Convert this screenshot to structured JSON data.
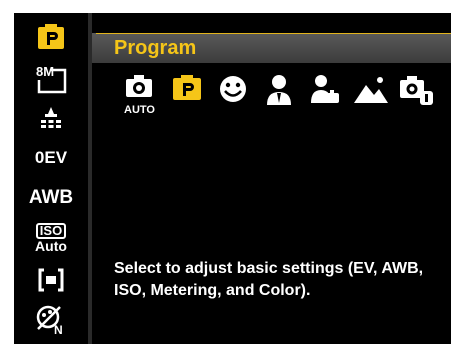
{
  "sidebar": {
    "items": [
      {
        "name": "program-mode",
        "icon": "program-p-icon"
      },
      {
        "name": "resolution",
        "label": "8M",
        "icon": "resolution-8m-icon"
      },
      {
        "name": "quality",
        "icon": "quality-stars-icon"
      },
      {
        "name": "exposure",
        "label": "0EV"
      },
      {
        "name": "white-balance",
        "label": "AWB"
      },
      {
        "name": "iso",
        "label_top": "ISO",
        "label_bottom": "Auto"
      },
      {
        "name": "metering",
        "icon": "metering-spot-icon"
      },
      {
        "name": "color",
        "label": "N",
        "icon": "color-effect-icon"
      }
    ],
    "selected_index": 0
  },
  "panel": {
    "title": "Program",
    "modes": [
      {
        "name": "auto",
        "label": "AUTO",
        "icon": "camera-auto-icon"
      },
      {
        "name": "program",
        "label": "P",
        "icon": "program-p-icon"
      },
      {
        "name": "smile",
        "icon": "smile-face-icon"
      },
      {
        "name": "portrait",
        "icon": "portrait-person-icon"
      },
      {
        "name": "scene",
        "icon": "scene-person-icon"
      },
      {
        "name": "landscape",
        "icon": "landscape-mountain-icon"
      },
      {
        "name": "scene-camera",
        "icon": "camera-scene-icon"
      }
    ],
    "description": "Select to adjust basic settings (EV, AWB, ISO, Metering, and Color)."
  },
  "colors": {
    "accent": "#f5c518",
    "background": "#000000",
    "title_bar": "#4a4a4a"
  }
}
